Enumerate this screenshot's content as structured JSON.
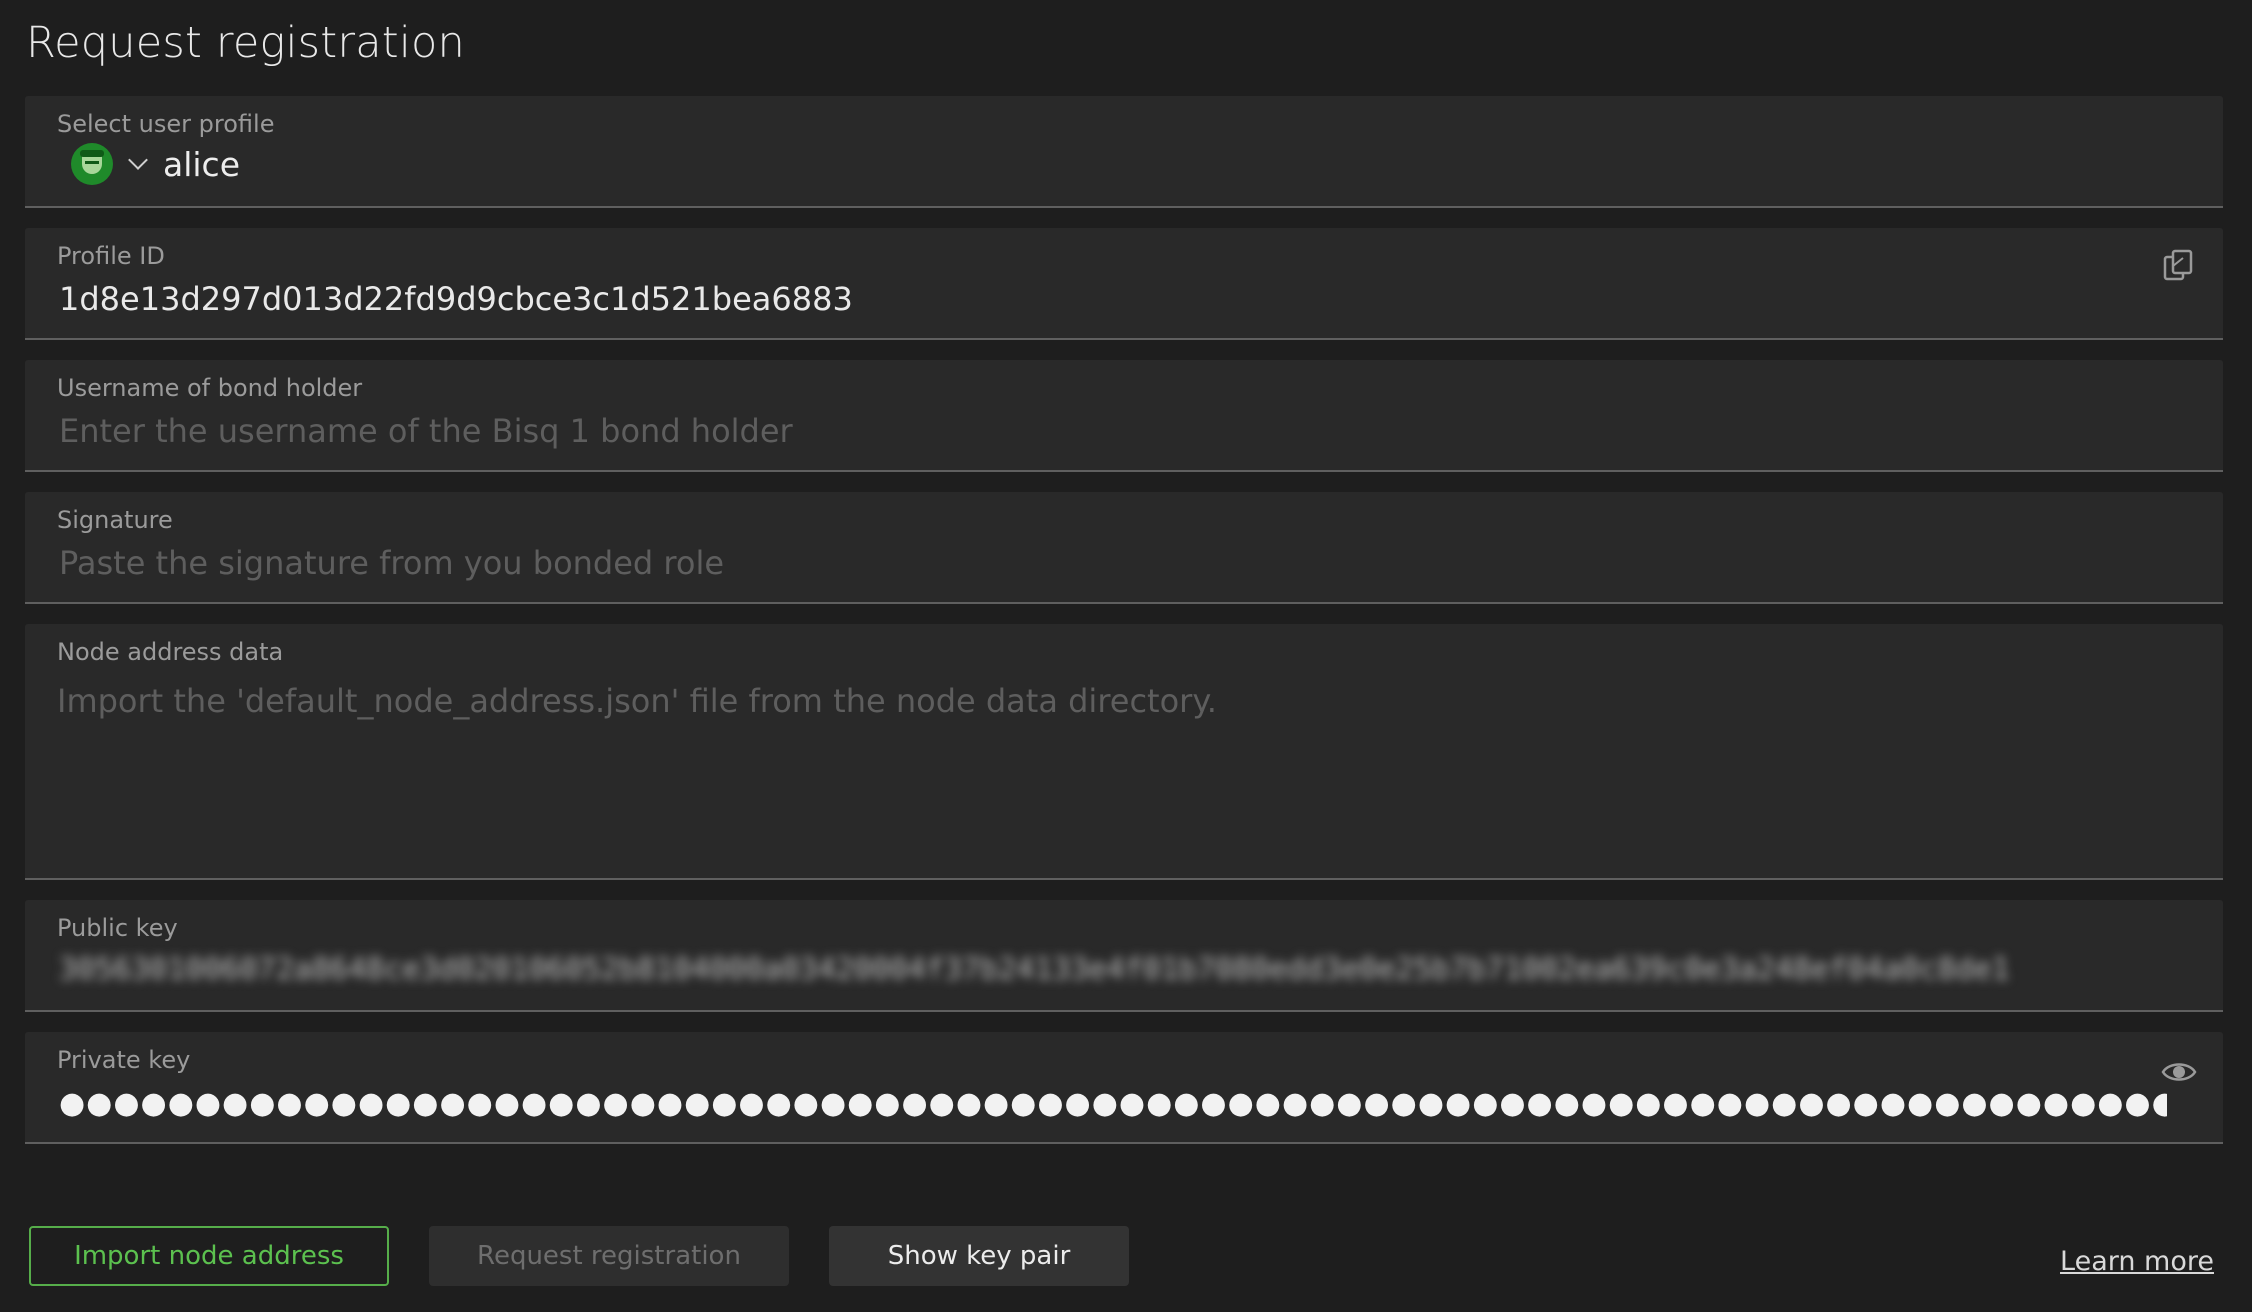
{
  "page": {
    "title": "Request registration"
  },
  "profile_select": {
    "label": "Select user profile",
    "value": "alice",
    "avatar_color": "#1f8a2a"
  },
  "profile_id": {
    "label": "Profile ID",
    "value": "1d8e13d297d013d22fd9d9cbce3c1d521bea6883",
    "copy_icon": "copy-icon"
  },
  "bond_holder": {
    "label": "Username of bond holder",
    "placeholder": "Enter the username of the Bisq 1 bond holder"
  },
  "signature": {
    "label": "Signature",
    "placeholder": "Paste the signature from you bonded role"
  },
  "node_address": {
    "label": "Node address data",
    "placeholder": "Import the 'default_node_address.json' file from the node data directory."
  },
  "public_key": {
    "label": "Public key",
    "value": "3056301006072a8648ce3d020106052b8104000a03420004f37b24133e4f01b7080edd3e0e25b7b71002ea639c0e3a248ef04a0c8de1"
  },
  "private_key": {
    "label": "Private key",
    "masked_value": "●●●●●●●●●●●●●●●●●●●●●●●●●●●●●●●●●●●●●●●●●●●●●●●●●●●●●●●●●●●●●●●●●●●●●●●●●●●●●●●●●●●●●●●●●●●●●●●●●●",
    "visibility_icon": "eye-icon"
  },
  "buttons": {
    "import_node": "Import node address",
    "request_registration": "Request registration",
    "show_key_pair": "Show key pair"
  },
  "links": {
    "learn_more": "Learn more"
  },
  "colors": {
    "background": "#1e1e1e",
    "field_background": "#292929",
    "accent_green": "#56ad4a"
  }
}
